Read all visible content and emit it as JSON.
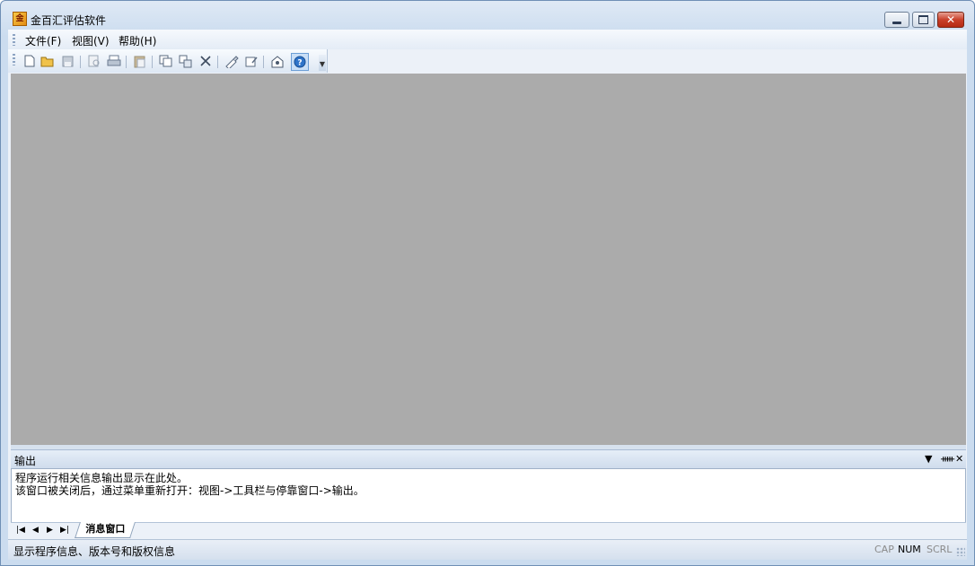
{
  "window": {
    "title": "金百汇评估软件",
    "icon": "app-logo-icon",
    "controls": [
      "minimize-icon",
      "maximize-icon",
      "close-icon"
    ]
  },
  "menu": [
    {
      "label": "文件(F)"
    },
    {
      "label": "视图(V)"
    },
    {
      "label": "帮助(H)"
    }
  ],
  "toolbar": {
    "buttons": [
      "new-icon",
      "open-icon",
      "save-icon",
      "preview-icon",
      "print-icon",
      "paste-icon",
      "copy-icon",
      "move-icon",
      "delete-icon",
      "brush-icon",
      "edit-icon",
      "about-icon",
      "help-icon"
    ]
  },
  "output_panel": {
    "title": "输出",
    "lines": [
      "程序运行相关信息输出显示在此处。",
      "该窗口被关闭后，通过菜单重新打开：视图->工具栏与停靠窗口->输出。"
    ],
    "tab_label": "消息窗口"
  },
  "status": {
    "text": "显示程序信息、版本号和版权信息",
    "indicators": [
      {
        "label": "CAP",
        "active": false
      },
      {
        "label": "NUM",
        "active": true
      },
      {
        "label": "SCRL",
        "active": false
      }
    ]
  },
  "colors": {
    "workspace": "#ababab",
    "frame": "#cbdcef"
  }
}
